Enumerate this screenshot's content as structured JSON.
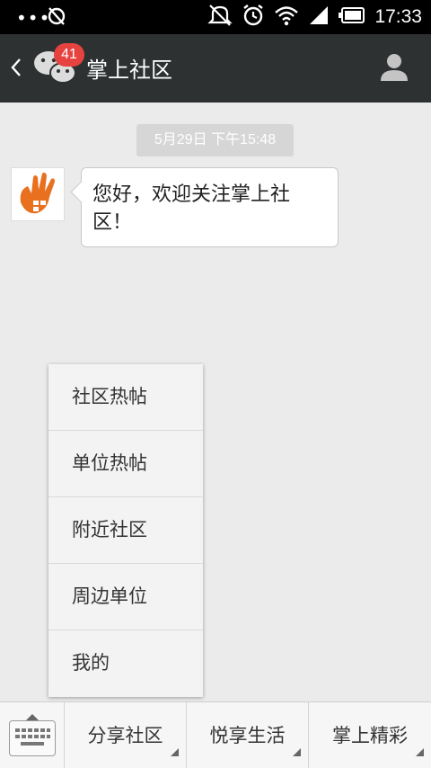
{
  "status_bar": {
    "time": "17:33",
    "icons": [
      "more-dots-icon",
      "sync-off-icon",
      "mute-icon",
      "alarm-icon",
      "wifi-icon",
      "signal-icon",
      "battery-icon"
    ]
  },
  "header": {
    "title": "掌上社区",
    "badge_count": "41",
    "icons": [
      "back-icon",
      "wechat-logo-icon",
      "profile-icon"
    ]
  },
  "chat": {
    "timestamp": "5月29日 下午15:48",
    "messages": [
      {
        "text": "您好，欢迎关注掌上社区！"
      }
    ]
  },
  "popup_menu": {
    "items": [
      "社区热帖",
      "单位热帖",
      "附近社区",
      "周边单位",
      "我的"
    ]
  },
  "bottom_bar": {
    "tabs": [
      "分享社区",
      "悦享生活",
      "掌上精彩"
    ],
    "icons": [
      "keyboard-icon"
    ]
  },
  "colors": {
    "header_bg": "#2e3132",
    "badge": "#e64340",
    "brand_orange": "#e8701e",
    "chat_bg": "#ebebeb"
  }
}
